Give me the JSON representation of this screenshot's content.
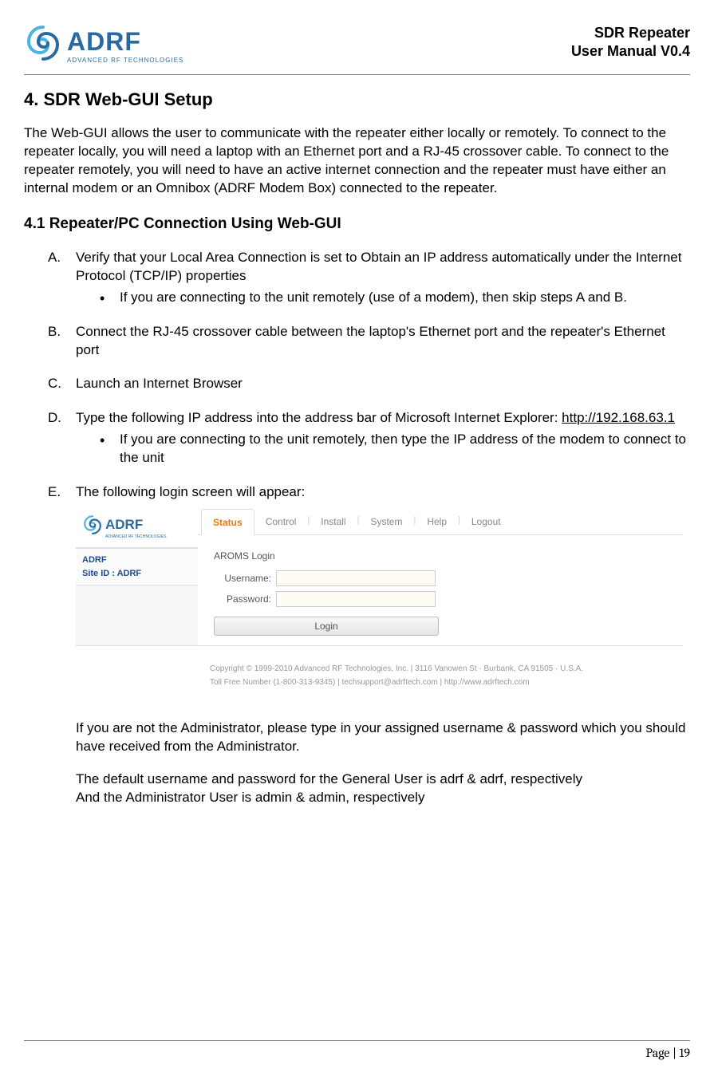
{
  "header": {
    "logo_main": "ADRF",
    "logo_sub": "ADVANCED RF TECHNOLOGIES",
    "title_line1": "SDR Repeater",
    "title_line2": "User Manual V0.4"
  },
  "section": {
    "title": "4. SDR Web-GUI Setup",
    "intro": "The Web-GUI allows the user to communicate with the repeater either locally or remotely.   To connect to the repeater locally, you will need a laptop with an Ethernet port and a RJ-45 crossover cable.   To connect to the repeater remotely, you will need to have an active internet connection and the repeater must have either an internal modem or an Omnibox (ADRF Modem Box) connected to the repeater.",
    "subheading": "4.1 Repeater/PC Connection Using Web-GUI"
  },
  "steps": {
    "a_marker": "A.",
    "a_text": "Verify that your Local Area Connection is set to Obtain an IP address automatically under the Internet Protocol (TCP/IP) properties",
    "a_sub": "If you are connecting to the unit remotely (use of a modem), then skip steps A and B.",
    "b_marker": "B.",
    "b_text": "Connect the RJ-45 crossover cable between the laptop's Ethernet port and the repeater's Ethernet port",
    "c_marker": "C.",
    "c_text": "Launch an Internet Browser",
    "d_marker": "D.",
    "d_text_pre": "Type the following IP address into the address bar of Microsoft Internet Explorer: ",
    "d_text_link": "http://192.168.63.1",
    "d_sub": "If you are connecting to the unit remotely, then type the IP address of the modem to connect to the unit",
    "e_marker": "E.",
    "e_text": "The following login screen will appear:"
  },
  "screenshot": {
    "logo_main": "ADRF",
    "logo_sub": "ADVANCED RF TECHNOLOGIES",
    "site_line1": "ADRF",
    "site_line2": "Site ID : ADRF",
    "tabs": [
      "Status",
      "Control",
      "Install",
      "System",
      "Help",
      "Logout"
    ],
    "form_title": "AROMS Login",
    "username_label": "Username:",
    "password_label": "Password:",
    "login_button": "Login",
    "footer_line1": "Copyright © 1999-2010 Advanced RF Technologies, Inc. | 3116 Vanowen St · Burbank, CA 91505 · U.S.A.",
    "footer_line2": "Toll Free Number (1-800-313-9345) | techsupport@adrftech.com | http://www.adrftech.com"
  },
  "after": {
    "p1": "If you are not the Administrator, please type in your assigned username & password which you should have received from the Administrator.",
    "p2": "The default username and password for the General User is adrf & adrf, respectively",
    "p3": "And the Administrator User is admin & admin, respectively"
  },
  "footer": {
    "page": "Page | 19"
  }
}
